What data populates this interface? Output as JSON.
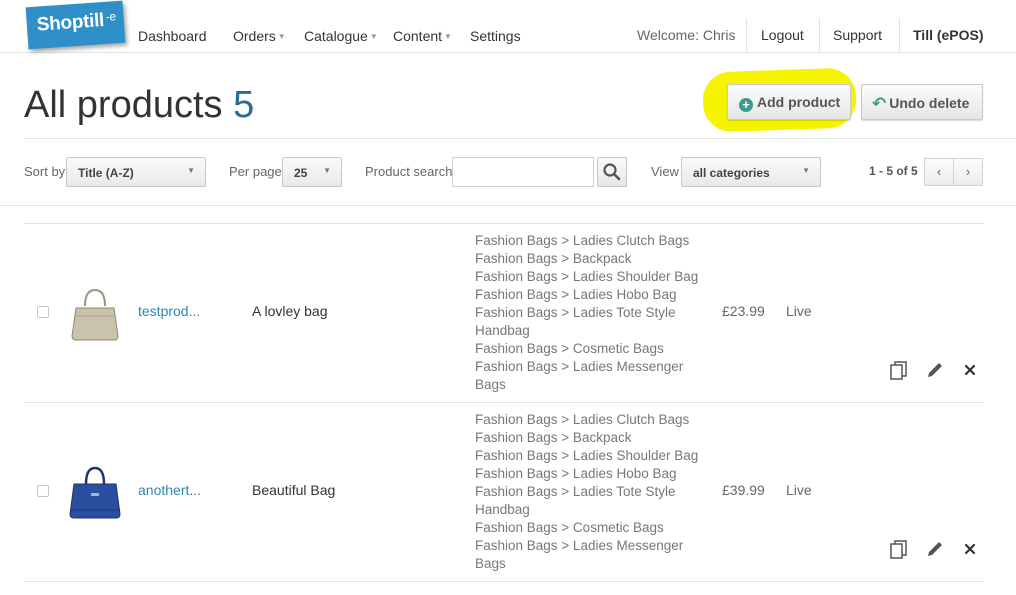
{
  "nav": {
    "logo_text": "Shoptill",
    "logo_suffix": "-e",
    "items": [
      {
        "label": "Dashboard",
        "dropdown": false
      },
      {
        "label": "Orders",
        "dropdown": true
      },
      {
        "label": "Catalogue",
        "dropdown": true
      },
      {
        "label": "Content",
        "dropdown": true
      },
      {
        "label": "Settings",
        "dropdown": false
      }
    ],
    "welcome": "Welcome: Chris",
    "logout": "Logout",
    "support": "Support",
    "till": "Till (ePOS)"
  },
  "header": {
    "title": "All products",
    "count": "5",
    "add_label": "Add product",
    "undo_label": "Undo delete"
  },
  "filters": {
    "sort_label": "Sort by",
    "sort_value": "Title (A-Z)",
    "perpage_label": "Per page",
    "perpage_value": "25",
    "search_label": "Product search",
    "search_value": "",
    "view_label": "View",
    "view_value": "all categories",
    "pager_text": "1 - 5 of 5"
  },
  "products": [
    {
      "name": "testprod...",
      "description": "A lovley bag",
      "categories": [
        "Fashion Bags > Ladies Clutch Bags",
        "Fashion Bags > Backpack",
        "Fashion Bags > Ladies Shoulder Bag",
        "Fashion Bags > Ladies Hobo Bag",
        "Fashion Bags > Ladies Tote Style Handbag",
        "Fashion Bags > Cosmetic Bags",
        "Fashion Bags > Ladies Messenger Bags"
      ],
      "price": "£23.99",
      "status": "Live",
      "thumb_color": "#c9c2ad"
    },
    {
      "name": "anothert...",
      "description": "Beautiful Bag",
      "categories": [
        "Fashion Bags > Ladies Clutch Bags",
        "Fashion Bags > Backpack",
        "Fashion Bags > Ladies Shoulder Bag",
        "Fashion Bags > Ladies Hobo Bag",
        "Fashion Bags > Ladies Tote Style Handbag",
        "Fashion Bags > Cosmetic Bags",
        "Fashion Bags > Ladies Messenger Bags"
      ],
      "price": "£39.99",
      "status": "Live",
      "thumb_color": "#2a4f9e"
    }
  ],
  "colors": {
    "brand": "#2f8fc9",
    "accent": "#3a9c8f",
    "link": "#2e86b5",
    "highlight": "#f5f300"
  }
}
